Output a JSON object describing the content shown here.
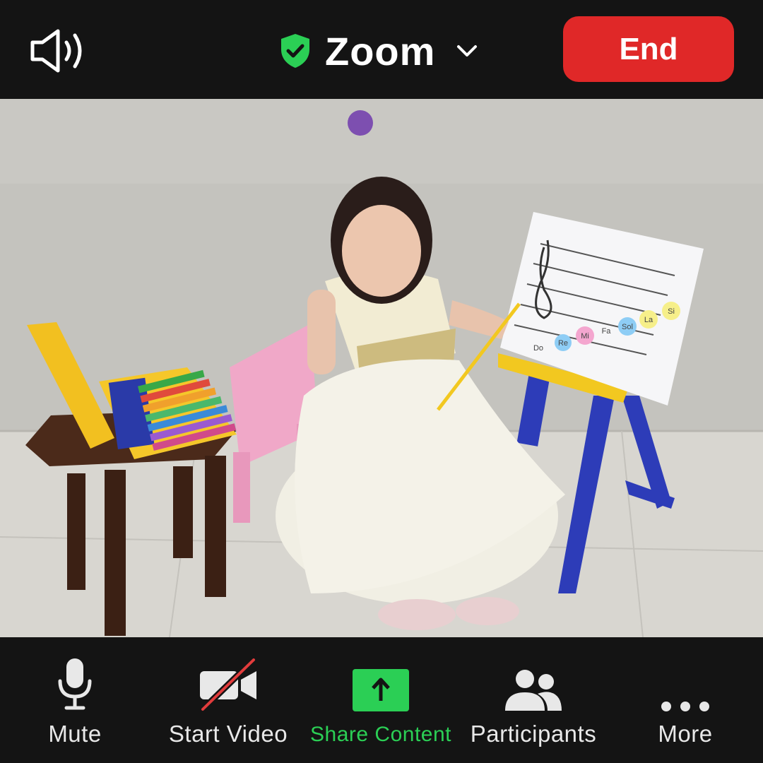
{
  "header": {
    "app_title": "Zoom",
    "end_label": "End",
    "shield_icon": "shield-check-icon",
    "speaker_icon": "speaker-icon",
    "dropdown_icon": "chevron-down-icon"
  },
  "video": {
    "content": "video-feed",
    "board_notes": [
      "Do",
      "Re",
      "Mi",
      "Fa",
      "Sol",
      "La",
      "Si"
    ]
  },
  "toolbar": {
    "items": [
      {
        "label": "Mute",
        "icon": "microphone-icon"
      },
      {
        "label": "Start Video",
        "icon": "video-camera-off-icon"
      },
      {
        "label": "Share Content",
        "icon": "share-upload-icon"
      },
      {
        "label": "Participants",
        "icon": "participants-icon"
      },
      {
        "label": "More",
        "icon": "more-dots-icon"
      }
    ]
  },
  "colors": {
    "background": "#141414",
    "end_button": "#e02828",
    "share_accent": "#2bcf55",
    "shield": "#2bcf55"
  }
}
